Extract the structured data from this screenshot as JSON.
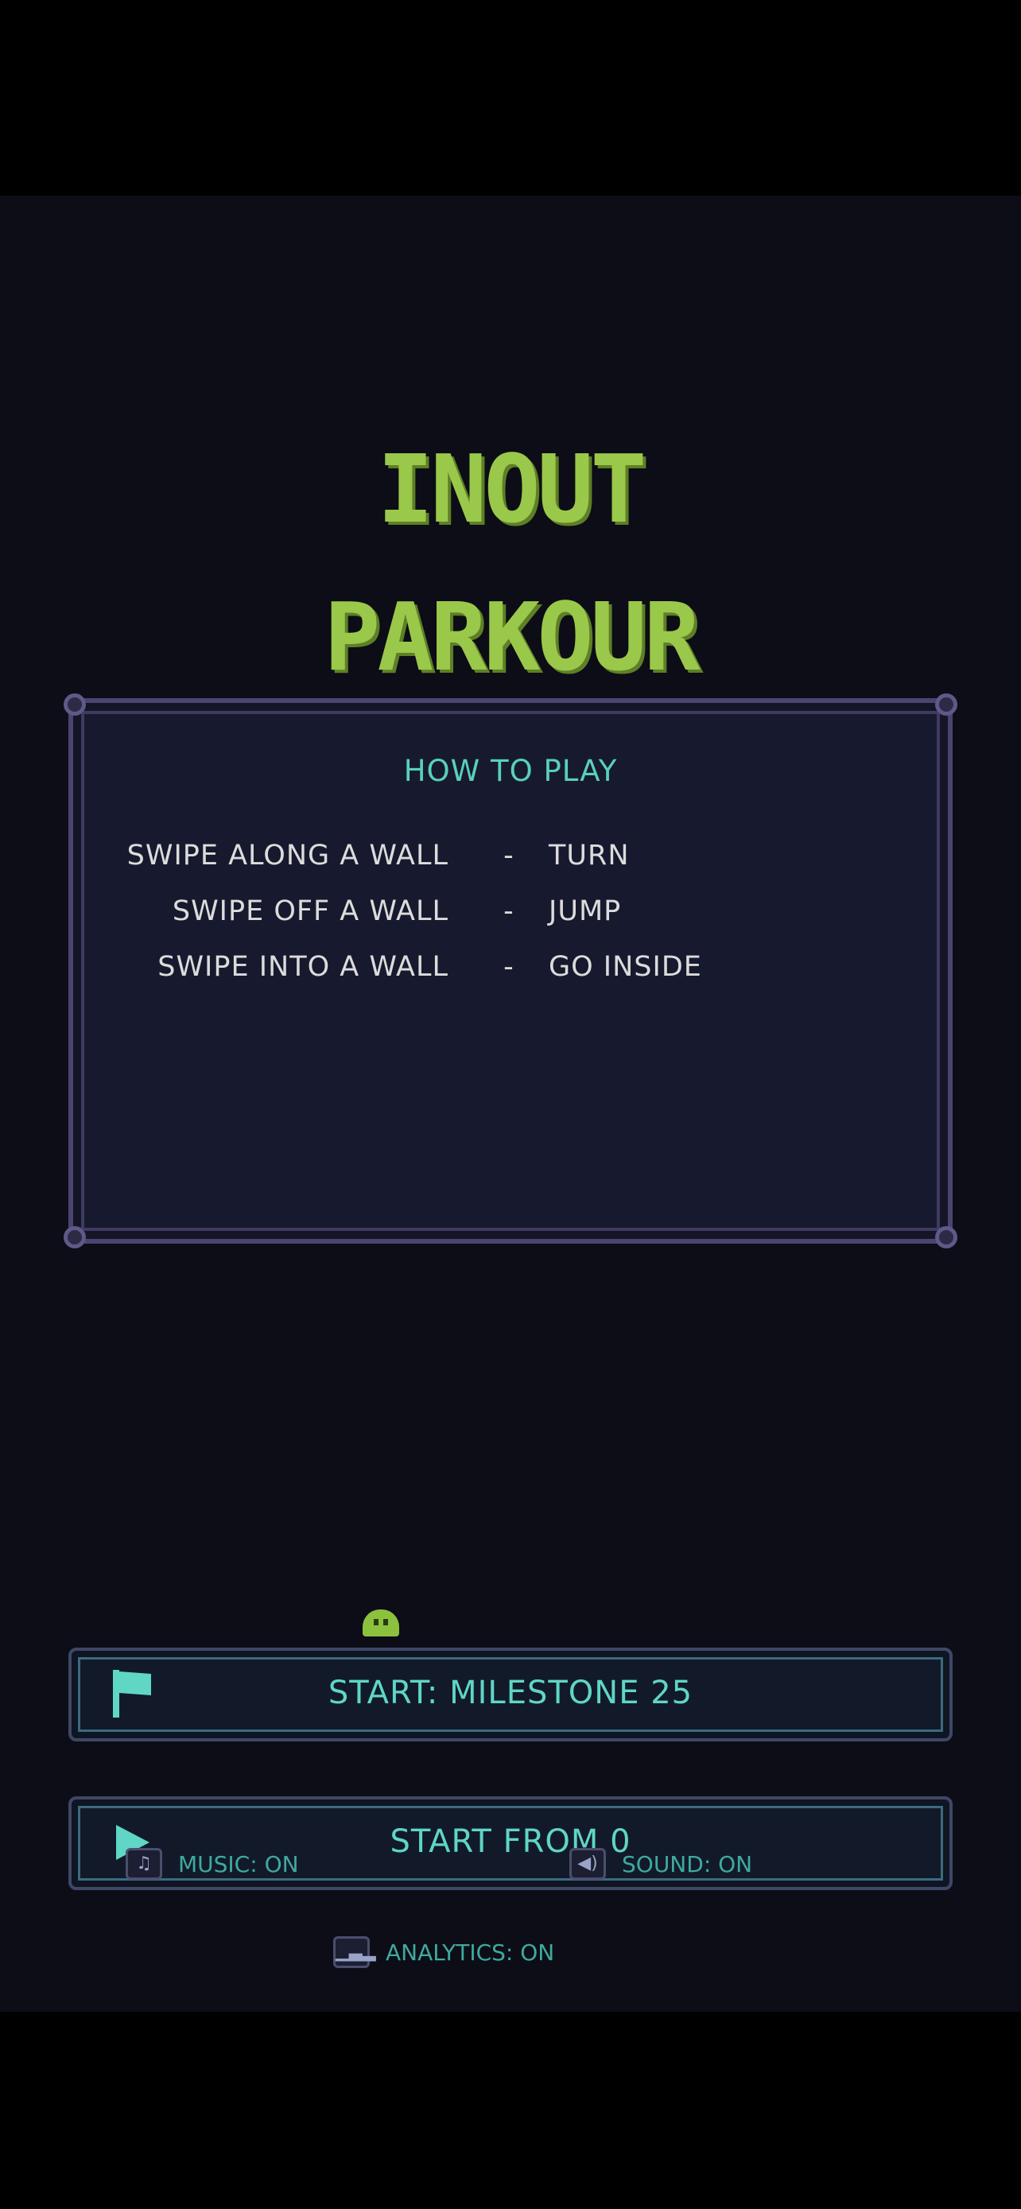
{
  "title": {
    "line1": "INOUT",
    "line2": "PARKOUR"
  },
  "how_to_play": {
    "heading": "HOW TO PLAY",
    "rules": [
      {
        "gesture": "SWIPE ALONG A WALL",
        "sep": "-",
        "action": "TURN"
      },
      {
        "gesture": "SWIPE OFF A WALL",
        "sep": "-",
        "action": "JUMP"
      },
      {
        "gesture": "SWIPE INTO A WALL",
        "sep": "-",
        "action": "GO INSIDE"
      }
    ]
  },
  "buttons": {
    "milestone": {
      "label": "START: MILESTONE 25",
      "icon": "flag-icon"
    },
    "start_zero": {
      "label": "START FROM 0",
      "icon": "play-icon"
    }
  },
  "settings": {
    "music": {
      "label": "MUSIC: ON",
      "icon": "music-note-icon"
    },
    "sound": {
      "label": "SOUND: ON",
      "icon": "speaker-icon"
    },
    "analytics": {
      "label": "ANALYTICS: ON",
      "icon": "bar-chart-icon"
    }
  },
  "colors": {
    "title_green": "#9ac84a",
    "accent_teal": "#5fd6c6",
    "background": "#0c0d16"
  }
}
